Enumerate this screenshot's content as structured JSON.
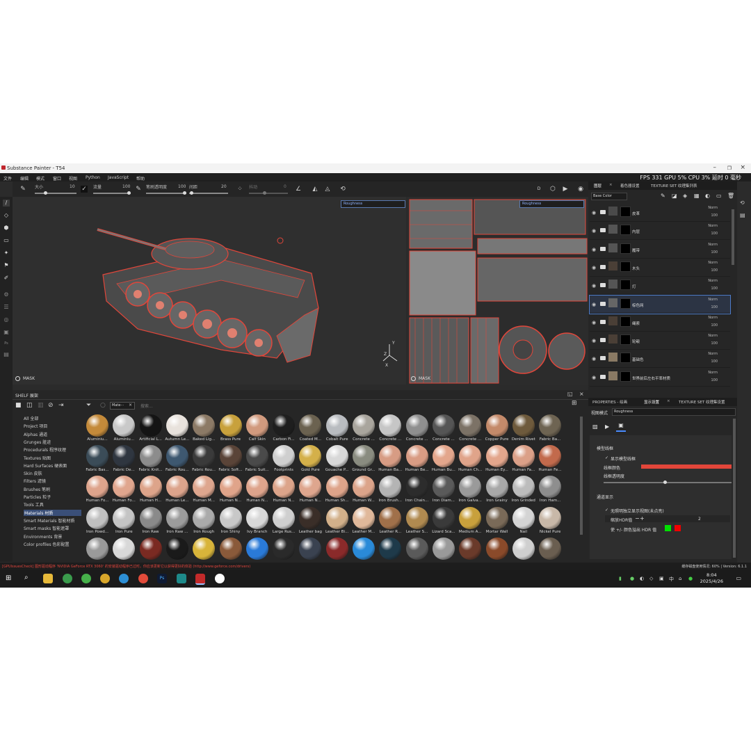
{
  "window": {
    "title": "Substance Painter - T54"
  },
  "menu": [
    "文件",
    "编辑",
    "模式",
    "窗口",
    "视图",
    "Python",
    "JavaScript",
    "帮助"
  ],
  "stats": {
    "text": "FPS 331 GPU 5% CPU 3% 延时 0 毫秒"
  },
  "toolbar": {
    "size_label": "大小",
    "size_value": "10",
    "flow_label": "流量",
    "flow_value": "100",
    "opacity_label": "笔刷透明度",
    "opacity_value": "100",
    "spacing_label": "间距",
    "spacing_value": "20",
    "angle_label": "抖动",
    "angle_value": "0"
  },
  "viewport3d": {
    "mode": "Roughness",
    "mask_label": "MASK"
  },
  "viewport2d": {
    "mode": "Roughness",
    "mask_label": "MASK"
  },
  "layers_panel": {
    "tabs": [
      "图层",
      "着色器设置",
      "TEXTURE SET 纹理集列表"
    ],
    "channel": "Base Color",
    "layers": [
      {
        "name": "皮革",
        "mode": "Norm",
        "opacity": "100"
      },
      {
        "name": "内层",
        "mode": "Norm",
        "opacity": "100"
      },
      {
        "name": "履带",
        "mode": "Norm",
        "opacity": "100"
      },
      {
        "name": "木头",
        "mode": "Norm",
        "opacity": "100"
      },
      {
        "name": "灯",
        "mode": "Norm",
        "opacity": "100"
      },
      {
        "name": "棕色网",
        "mode": "Norm",
        "opacity": "100"
      },
      {
        "name": "绳索",
        "mode": "Norm",
        "opacity": "100"
      },
      {
        "name": "轮毂",
        "mode": "Norm",
        "opacity": "100"
      },
      {
        "name": "基础色",
        "mode": "Norm",
        "opacity": "100"
      },
      {
        "name": "世界前后左右平率材质",
        "mode": "Norm",
        "opacity": "100"
      }
    ]
  },
  "properties": {
    "tabs": [
      "PROPERTIES - 绘画",
      "显示设置",
      "TEXTURE SET 纹理集设置"
    ],
    "view_mode_label": "视图模式",
    "view_mode_value": "Roughness",
    "wireframe_section": "模型线框",
    "show_wireframe": "显示模型线框",
    "wireframe_color_label": "线框颜色",
    "wireframe_opacity_label": "线框透明度",
    "channel_section": "通道显示",
    "isolate_label": "无照明独立显示视图(未点亮)",
    "hdr_scale_label": "缩放HDR值",
    "hdr_scale_value": "2",
    "hdr_color_label": "使 +/- 颜色溢出 HDR 值",
    "wireframe_color": "#e2463a"
  },
  "shelf": {
    "title": "SHELF 展架",
    "search_tag": "Mate···",
    "search_placeholder": "搜索...",
    "categories": [
      "All 全部",
      "Project 项目",
      "Alphas 通道",
      "Grunges 脏迹",
      "Procedurals 程序纹理",
      "Textures 贴图",
      "Hard Surfaces 硬表面",
      "Skin 皮肤",
      "Filters 滤镜",
      "Brushes 笔刷",
      "Particles 粒子",
      "Tools 工具",
      "Materials 材质",
      "Smart Materials 智能材质",
      "Smart masks 智能遮罩",
      "Environments 背景",
      "Color profiles 色彩配置"
    ],
    "selected_category": "Materials 材质",
    "materials": [
      {
        "name": "Aluminiu...",
        "color": "#c48a3a"
      },
      {
        "name": "Aluminiu...",
        "color": "#c9c9c9"
      },
      {
        "name": "Artificial L...",
        "color": "#141414"
      },
      {
        "name": "Autumn Le...",
        "color": "#e8e2dc"
      },
      {
        "name": "Baked Lig...",
        "color": "#8c7a66"
      },
      {
        "name": "Brass Pure",
        "color": "#c8a13c"
      },
      {
        "name": "Calf Skin",
        "color": "#d19a7e"
      },
      {
        "name": "Carbon Fi...",
        "color": "#1e1e1e"
      },
      {
        "name": "Coated M...",
        "color": "#6b6250"
      },
      {
        "name": "Cobalt Pure",
        "color": "#b9bcc0"
      },
      {
        "name": "Concrete ...",
        "color": "#a9a59d"
      },
      {
        "name": "Concrete ...",
        "color": "#c6c6c6"
      },
      {
        "name": "Concrete ...",
        "color": "#8f8f8f"
      },
      {
        "name": "Concrete ...",
        "color": "#555555"
      },
      {
        "name": "Concrete ...",
        "color": "#7c7266"
      },
      {
        "name": "Copper Pure",
        "color": "#c48a6a"
      },
      {
        "name": "Denim Rivet",
        "color": "#6e5a3c"
      },
      {
        "name": "Fabric Ba...",
        "color": "#6e6452"
      },
      {
        "name": "Fabric Bas...",
        "color": "#3b4c58"
      },
      {
        "name": "Fabric De...",
        "color": "#2f3640"
      },
      {
        "name": "Fabric Knit...",
        "color": "#8c8c8c"
      },
      {
        "name": "Fabric Rou...",
        "color": "#3e5870"
      },
      {
        "name": "Fabric Rou...",
        "color": "#3a3a3a"
      },
      {
        "name": "Fabric Soft...",
        "color": "#5a4438"
      },
      {
        "name": "Fabric Suit...",
        "color": "#4a4a4a"
      },
      {
        "name": "Footprints",
        "color": "#cfcfcf"
      },
      {
        "name": "Gold Pure",
        "color": "#d4b04a"
      },
      {
        "name": "Gouache P...",
        "color": "#d8d8d8"
      },
      {
        "name": "Ground Gr...",
        "color": "#8a8c80"
      },
      {
        "name": "Human Ba...",
        "color": "#d79c84"
      },
      {
        "name": "Human Be...",
        "color": "#d99c84"
      },
      {
        "name": "Human Bu...",
        "color": "#e3a68c"
      },
      {
        "name": "Human Ch...",
        "color": "#e0a48a"
      },
      {
        "name": "Human Ey...",
        "color": "#e3a68c"
      },
      {
        "name": "Human Fa...",
        "color": "#dba088"
      },
      {
        "name": "Human Fe...",
        "color": "#c26a4c"
      },
      {
        "name": "Human Fo...",
        "color": "#dea48c"
      },
      {
        "name": "Human Fo...",
        "color": "#e0a68e"
      },
      {
        "name": "Human H...",
        "color": "#dda48a"
      },
      {
        "name": "Human Le...",
        "color": "#dca48c"
      },
      {
        "name": "Human M...",
        "color": "#dea68e"
      },
      {
        "name": "Human N...",
        "color": "#e0a48a"
      },
      {
        "name": "Human N...",
        "color": "#dea48c"
      },
      {
        "name": "Human N...",
        "color": "#dca48a"
      },
      {
        "name": "Human N...",
        "color": "#dea68e"
      },
      {
        "name": "Human Sh...",
        "color": "#dea48a"
      },
      {
        "name": "Human W...",
        "color": "#dca48a"
      },
      {
        "name": "Iron Brush...",
        "color": "#b4b4b4"
      },
      {
        "name": "Iron Chain...",
        "color": "#2c2c2c"
      },
      {
        "name": "Iron Diam...",
        "color": "#5a5a5a"
      },
      {
        "name": "Iron Galva...",
        "color": "#9a9a9a"
      },
      {
        "name": "Iron Grainy",
        "color": "#a8a8a8"
      },
      {
        "name": "Iron Grinded",
        "color": "#bcbcbc"
      },
      {
        "name": "Iron Ham...",
        "color": "#8e8e8e"
      },
      {
        "name": "Iron Powd...",
        "color": "#c0c0c0"
      },
      {
        "name": "Iron Pure",
        "color": "#c4c4c4"
      },
      {
        "name": "Iron Raw",
        "color": "#8a8a8a"
      },
      {
        "name": "Iron Raw ...",
        "color": "#9c9c9c"
      },
      {
        "name": "Iron Rough",
        "color": "#aaaaaa"
      },
      {
        "name": "Iron Shiny",
        "color": "#c8c8c8"
      },
      {
        "name": "Ivy Branch",
        "color": "#d8d8d8"
      },
      {
        "name": "Large Rus...",
        "color": "#cfcfcf"
      },
      {
        "name": "Leather bag",
        "color": "#3a2e28"
      },
      {
        "name": "Leather Bi...",
        "color": "#d2b08a"
      },
      {
        "name": "Leather M...",
        "color": "#e0b89a"
      },
      {
        "name": "Leather R...",
        "color": "#a0704a"
      },
      {
        "name": "Leather S...",
        "color": "#b08a50"
      },
      {
        "name": "Lizard Sca...",
        "color": "#3a3a3a"
      },
      {
        "name": "Medium A...",
        "color": "#c8a03c"
      },
      {
        "name": "Mortar Wall",
        "color": "#7a6a58"
      },
      {
        "name": "Nail",
        "color": "#d4d4d4"
      },
      {
        "name": "Nickel Pure",
        "color": "#c8b8a8"
      },
      {
        "name": "",
        "color": "#9a9a9a"
      },
      {
        "name": "",
        "color": "#d8d8d8"
      },
      {
        "name": "",
        "color": "#7a2a22"
      },
      {
        "name": "",
        "color": "#1a1a1a"
      },
      {
        "name": "",
        "color": "#d8b43a"
      },
      {
        "name": "",
        "color": "#8a5a3a"
      },
      {
        "name": "",
        "color": "#2a7ad8"
      },
      {
        "name": "",
        "color": "#2a2a2a"
      },
      {
        "name": "",
        "color": "#3a4250"
      },
      {
        "name": "",
        "color": "#8a2a2a"
      },
      {
        "name": "",
        "color": "#2a8ad8"
      },
      {
        "name": "",
        "color": "#1e3a4a"
      },
      {
        "name": "",
        "color": "#5a5a5a"
      },
      {
        "name": "",
        "color": "#9a9a9a"
      },
      {
        "name": "",
        "color": "#6a3a2a"
      },
      {
        "name": "",
        "color": "#8a4a2a"
      },
      {
        "name": "",
        "color": "#cfcfcf"
      },
      {
        "name": "",
        "color": "#6a5e50"
      }
    ]
  },
  "status": {
    "error": "[GPUIssuesCheck] 图形驱动程序  'NVIDIA GeForce RTX 3060'  的安装驱动程序已过时。你应该更新它以获得更好的体验 (http://www.geforce.com/drivers)",
    "memory": "缓存磁盘使用情况: 60% | Version: 6.1.1"
  },
  "taskbar": {
    "time": "8:04",
    "date": "2025/4/26"
  }
}
